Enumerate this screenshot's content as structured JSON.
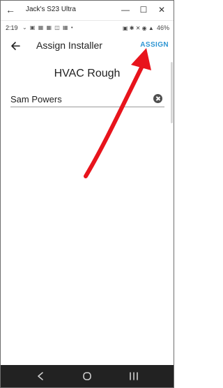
{
  "window": {
    "title": "Jack's S23 Ultra",
    "back_glyph": "←",
    "minimize_glyph": "—",
    "maximize_glyph": "☐",
    "close_glyph": "✕"
  },
  "status_bar": {
    "time": "2:19",
    "notification_icons": "⌄ ▣ ▦ ▦ ◫ ▦ •",
    "system_icons": "▣ ✱ ✕ ◉ ▲",
    "battery": "46%"
  },
  "toolbar": {
    "title": "Assign Installer",
    "assign_label": "ASSIGN",
    "back_icon": "arrow-left-icon"
  },
  "content": {
    "task_name": "HVAC Rough",
    "installer_value": "Sam Powers",
    "clear_icon": "clear-circle-icon"
  },
  "annotation": {
    "arrow_color": "#e8141c"
  },
  "nav_bar": {
    "back_icon": "chevron-left-icon",
    "home_icon": "home-circle-icon",
    "recents_icon": "recents-bars-icon"
  }
}
